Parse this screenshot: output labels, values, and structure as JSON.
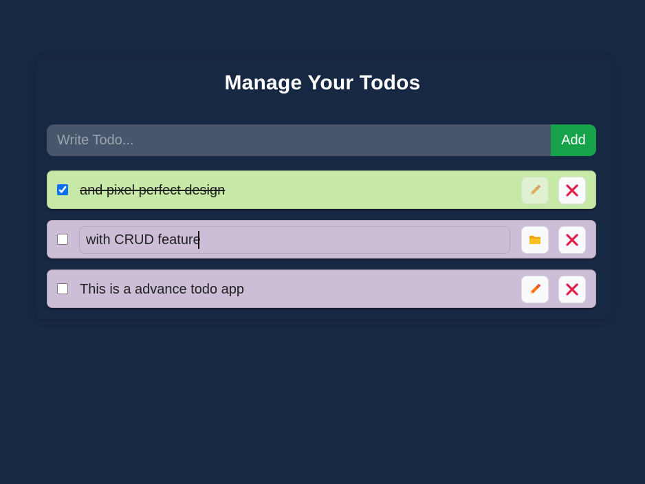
{
  "header": {
    "title": "Manage Your Todos"
  },
  "form": {
    "placeholder": "Write Todo...",
    "value": "",
    "add_label": "Add"
  },
  "todos": [
    {
      "text": "and pixel perfect design",
      "completed": true,
      "editing": false,
      "edit_icon": "pencil-icon",
      "delete_icon": "close-icon"
    },
    {
      "text": "with CRUD feature",
      "completed": false,
      "editing": true,
      "edit_icon": "folder-icon",
      "delete_icon": "close-icon"
    },
    {
      "text": "This is a advance todo app",
      "completed": false,
      "editing": false,
      "edit_icon": "pencil-icon",
      "delete_icon": "close-icon"
    }
  ],
  "colors": {
    "background": "#172842",
    "completed_item": "#c6e9a7",
    "pending_item": "#ccbed7",
    "add_button": "#16a34a",
    "input_bg": "#47566b",
    "delete_icon": "#e11d48",
    "edit_icon": "#f97316",
    "folder_icon": "#fbbf24"
  }
}
